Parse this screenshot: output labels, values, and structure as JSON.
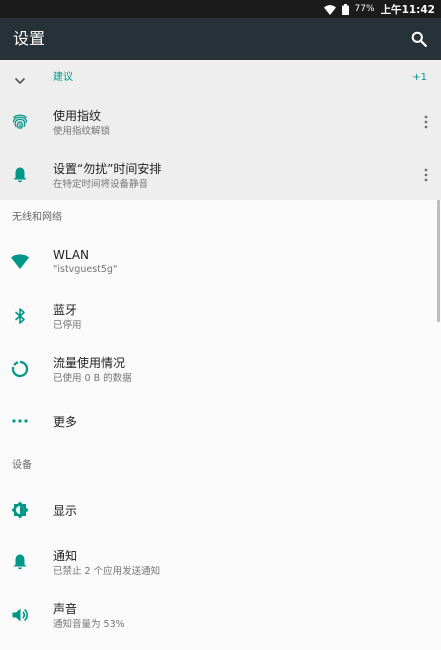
{
  "status_bar": {
    "battery_percent": "77%",
    "time_prefix": "上午",
    "time": "11:42"
  },
  "app_bar": {
    "title": "设置"
  },
  "suggestions": {
    "label": "建议",
    "count": "+1",
    "items": [
      {
        "title": "使用指纹",
        "subtitle": "使用指纹解锁",
        "icon": "fingerprint-icon"
      },
      {
        "title": "设置“勿扰”时间安排",
        "subtitle": "在特定时间将设备静音",
        "icon": "bell-icon"
      }
    ]
  },
  "wireless": {
    "header": "无线和网络",
    "items": [
      {
        "title": "WLAN",
        "subtitle": "\"istvguest5g\"",
        "icon": "wifi-icon"
      },
      {
        "title": "蓝牙",
        "subtitle": "已停用",
        "icon": "bluetooth-icon"
      },
      {
        "title": "流量使用情况",
        "subtitle": "已使用 0 B 的数据",
        "icon": "data-usage-icon"
      },
      {
        "title": "更多",
        "subtitle": "",
        "icon": "more-horiz-icon"
      }
    ]
  },
  "device": {
    "header": "设备",
    "items": [
      {
        "title": "显示",
        "subtitle": "",
        "icon": "brightness-icon"
      },
      {
        "title": "通知",
        "subtitle": "已禁止 2 个应用发送通知",
        "icon": "bell-icon"
      },
      {
        "title": "声音",
        "subtitle": "通知音量为 53%",
        "icon": "volume-icon"
      }
    ]
  },
  "colors": {
    "accent": "#009688",
    "app_bar": "#263238",
    "status_bar": "#1b1b1b",
    "suggestion_bg": "#eeeeee",
    "page_bg": "#fafafa"
  }
}
